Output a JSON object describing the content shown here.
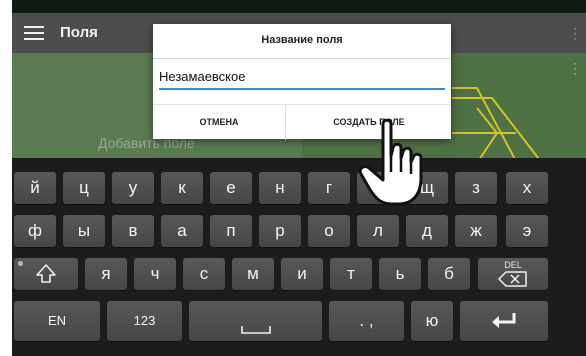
{
  "app": {
    "title": "Поля"
  },
  "map": {
    "add_field_hint": "Добавить поле"
  },
  "dialog": {
    "title": "Название поля",
    "input_value": "Незамаевское",
    "cancel_label": "ОТМЕНА",
    "create_label": "СОЗДАТЬ ПОЛЕ"
  },
  "keyboard": {
    "row1": [
      "й",
      "ц",
      "у",
      "к",
      "е",
      "н",
      "г",
      "ш",
      "щ",
      "з",
      "х"
    ],
    "row2": [
      "ф",
      "ы",
      "в",
      "а",
      "п",
      "р",
      "о",
      "л",
      "д",
      "ж",
      "э"
    ],
    "row3": [
      "я",
      "ч",
      "с",
      "м",
      "и",
      "т",
      "ь",
      "б"
    ],
    "lang_label": "EN",
    "numbers_label": "123",
    "punct_label": ". ,",
    "yu_label": "ю",
    "del_label": "DEL"
  },
  "icons": {
    "menu": "hamburger-menu-icon",
    "shift": "shift-icon",
    "backspace": "backspace-icon",
    "space": "space-bar-icon",
    "enter": "enter-icon",
    "pointer": "hand-pointer-icon"
  },
  "colors": {
    "app_bar": "#4d4d4d",
    "map": "#5a7b52",
    "keyboard": "#1c1c1c",
    "input_accent": "#2f8fd1"
  }
}
